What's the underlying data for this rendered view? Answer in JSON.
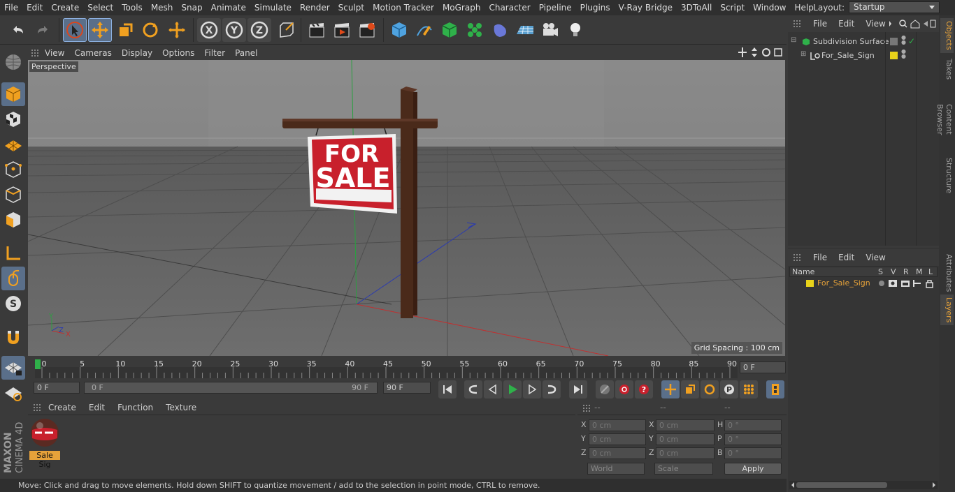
{
  "menu": [
    "File",
    "Edit",
    "Create",
    "Select",
    "Tools",
    "Mesh",
    "Snap",
    "Animate",
    "Simulate",
    "Render",
    "Sculpt",
    "Motion Tracker",
    "MoGraph",
    "Character",
    "Pipeline",
    "Plugins",
    "V-Ray Bridge",
    "3DToAll",
    "Script",
    "Window",
    "Help"
  ],
  "layout": {
    "label": "Layout:",
    "value": "Startup"
  },
  "viewport": {
    "menu": [
      "View",
      "Cameras",
      "Display",
      "Options",
      "Filter",
      "Panel"
    ],
    "label": "Perspective",
    "grid_spacing": "Grid Spacing : 100 cm",
    "sign_line1": "FOR",
    "sign_line2": "SALE",
    "axis_y": "Y",
    "axis_z": "Z",
    "axis_x": "X"
  },
  "timeline": {
    "ticks": [
      "0",
      "5",
      "10",
      "15",
      "20",
      "25",
      "30",
      "35",
      "40",
      "45",
      "50",
      "55",
      "60",
      "65",
      "70",
      "75",
      "80",
      "85",
      "90"
    ],
    "current_frame": "0 F"
  },
  "transport": {
    "start": "0 F",
    "range_start": "0 F",
    "range_end": "90 F",
    "end": "90 F"
  },
  "materials": {
    "menu": [
      "Create",
      "Edit",
      "Function",
      "Texture"
    ],
    "items": [
      {
        "name": "Sale Sig"
      }
    ]
  },
  "coords": {
    "headers": [
      "--",
      "--",
      "--"
    ],
    "rows": [
      {
        "a": "X",
        "av": "0 cm",
        "b": "X",
        "bv": "0 cm",
        "c": "H",
        "cv": "0 °"
      },
      {
        "a": "Y",
        "av": "0 cm",
        "b": "Y",
        "bv": "0 cm",
        "c": "P",
        "cv": "0 °"
      },
      {
        "a": "Z",
        "av": "0 cm",
        "b": "Z",
        "bv": "0 cm",
        "c": "B",
        "cv": "0 °"
      }
    ],
    "mode": "World",
    "scale": "Scale",
    "apply": "Apply"
  },
  "status": "Move: Click and drag to move elements. Hold down SHIFT to quantize movement / add to the selection in point mode, CTRL to remove.",
  "objects": {
    "menu": [
      "File",
      "Edit",
      "View"
    ],
    "items": [
      {
        "name": "Subdivision Surface"
      },
      {
        "name": "For_Sale_Sign"
      }
    ]
  },
  "layers": {
    "menu": [
      "File",
      "Edit",
      "View"
    ],
    "col_name": "Name",
    "cols": [
      "S",
      "V",
      "R",
      "M",
      "L"
    ],
    "items": [
      {
        "name": "For_Sale_Sign"
      }
    ]
  },
  "side_tabs": [
    "Objects",
    "Takes",
    "Content Browser",
    "Structure"
  ],
  "side_tabs_lower": [
    "Attributes",
    "Layers"
  ],
  "brand": {
    "line1": "MAXON",
    "line2": "CINEMA 4D"
  },
  "colors": {
    "accent": "#e6a23a",
    "sign_red": "#c8202c",
    "wood": "#4a2a1a",
    "layer_yellow": "#e8d21a"
  }
}
